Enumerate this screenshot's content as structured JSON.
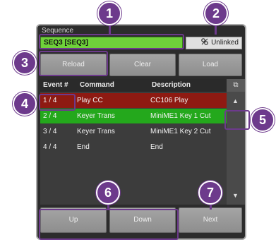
{
  "panel": {
    "title": "Sequence",
    "sequence_name": "SEQ3 [SEQ3]",
    "link_label": "Unlinked",
    "buttons": {
      "reload": "Reload",
      "clear": "Clear",
      "load": "Load"
    },
    "bottom_buttons": {
      "up": "Up",
      "down": "Down",
      "next": "Next"
    }
  },
  "table": {
    "columns": [
      "Event #",
      "Command",
      "Description"
    ],
    "rows": [
      {
        "event": "1 / 4",
        "command": "Play CC",
        "description": "CC106 Play"
      },
      {
        "event": "2 / 4",
        "command": "Keyer Trans",
        "description": "MiniME1 Key 1 Cut"
      },
      {
        "event": "3 / 4",
        "command": "Keyer Trans",
        "description": "MiniME1 Key 2 Cut"
      },
      {
        "event": "4 / 4",
        "command": "End",
        "description": "End"
      }
    ],
    "scroll": {
      "header_glyph": "⧉",
      "up_glyph": "▲",
      "down_glyph": "▼"
    }
  },
  "callouts": [
    "1",
    "2",
    "3",
    "4",
    "5",
    "6",
    "7"
  ],
  "colors": {
    "callout": "#6d3a8c",
    "active_row": "#8e1a12",
    "next_row": "#24a81c",
    "sequence_field": "#6fd13a"
  },
  "icons": {
    "link": "unlinked-chain-icon"
  }
}
